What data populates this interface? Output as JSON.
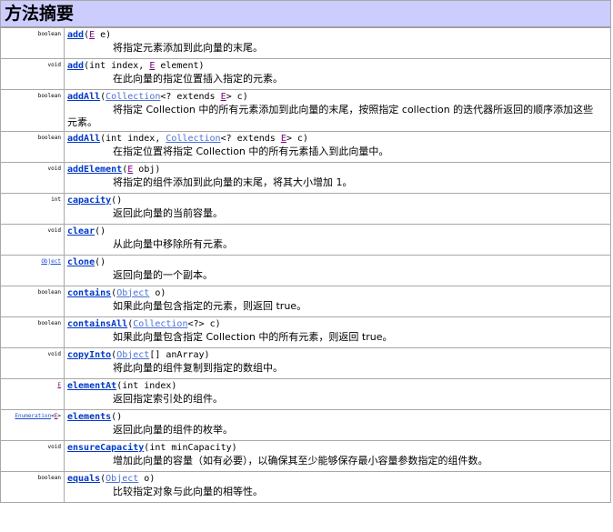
{
  "section_title": "方法摘要",
  "colors": {
    "header_bg": "#ccccff",
    "method_link": "#0038c8",
    "type_link": "#4a70d8",
    "generic_type": "#800080"
  },
  "methods": [
    {
      "return": "boolean",
      "name": "add",
      "params": [
        {
          "text": "("
        },
        {
          "link": "E",
          "kind": "generic"
        },
        {
          "text": " e)"
        }
      ],
      "desc": "将指定元素添加到此向量的末尾。"
    },
    {
      "return": "void",
      "name": "add",
      "params": [
        {
          "text": "(int index, "
        },
        {
          "link": "E",
          "kind": "generic"
        },
        {
          "text": " element)"
        }
      ],
      "desc": "在此向量的指定位置插入指定的元素。"
    },
    {
      "return": "boolean",
      "name": "addAll",
      "params": [
        {
          "text": "("
        },
        {
          "link": "Collection",
          "kind": "type"
        },
        {
          "text": "<? extends "
        },
        {
          "link": "E",
          "kind": "generic"
        },
        {
          "text": "> c)"
        }
      ],
      "desc": "将指定 Collection 中的所有元素添加到此向量的末尾，按照指定 collection 的迭代器所返回的顺序添加这些元素。",
      "wrap": true
    },
    {
      "return": "boolean",
      "name": "addAll",
      "params": [
        {
          "text": "(int index, "
        },
        {
          "link": "Collection",
          "kind": "type"
        },
        {
          "text": "<? extends "
        },
        {
          "link": "E",
          "kind": "generic"
        },
        {
          "text": "> c)"
        }
      ],
      "desc": "在指定位置将指定 Collection 中的所有元素插入到此向量中。"
    },
    {
      "return": "void",
      "name": "addElement",
      "params": [
        {
          "text": "("
        },
        {
          "link": "E",
          "kind": "generic"
        },
        {
          "text": " obj)"
        }
      ],
      "desc": "将指定的组件添加到此向量的末尾，将其大小增加 1。"
    },
    {
      "return": "int",
      "name": "capacity",
      "params": [
        {
          "text": "()"
        }
      ],
      "desc": "返回此向量的当前容量。"
    },
    {
      "return": "void",
      "name": "clear",
      "params": [
        {
          "text": "()"
        }
      ],
      "desc": "从此向量中移除所有元素。"
    },
    {
      "return": "Object",
      "return_link": true,
      "name": "clone",
      "params": [
        {
          "text": "()"
        }
      ],
      "desc": "返回向量的一个副本。"
    },
    {
      "return": "boolean",
      "name": "contains",
      "params": [
        {
          "text": "("
        },
        {
          "link": "Object",
          "kind": "type"
        },
        {
          "text": " o)"
        }
      ],
      "desc": "如果此向量包含指定的元素，则返回 true。"
    },
    {
      "return": "boolean",
      "name": "containsAll",
      "params": [
        {
          "text": "("
        },
        {
          "link": "Collection",
          "kind": "type"
        },
        {
          "text": "<?> c)"
        }
      ],
      "desc": "如果此向量包含指定 Collection 中的所有元素，则返回 true。"
    },
    {
      "return": "void",
      "name": "copyInto",
      "params": [
        {
          "text": "("
        },
        {
          "link": "Object",
          "kind": "type"
        },
        {
          "text": "[] anArray)"
        }
      ],
      "desc": "将此向量的组件复制到指定的数组中。"
    },
    {
      "return": "E",
      "return_generic": true,
      "name": "elementAt",
      "params": [
        {
          "text": "(int index)"
        }
      ],
      "desc": "返回指定索引处的组件。"
    },
    {
      "return": "Enumeration",
      "return_link": true,
      "return_suffix_generic": "E",
      "name": "elements",
      "params": [
        {
          "text": "()"
        }
      ],
      "desc": "返回此向量的组件的枚举。"
    },
    {
      "return": "void",
      "name": "ensureCapacity",
      "params": [
        {
          "text": "(int minCapacity)"
        }
      ],
      "desc": "增加此向量的容量（如有必要），以确保其至少能够保存最小容量参数指定的组件数。"
    },
    {
      "return": "boolean",
      "name": "equals",
      "params": [
        {
          "text": "("
        },
        {
          "link": "Object",
          "kind": "type"
        },
        {
          "text": " o)"
        }
      ],
      "desc": "比较指定对象与此向量的相等性。"
    }
  ]
}
